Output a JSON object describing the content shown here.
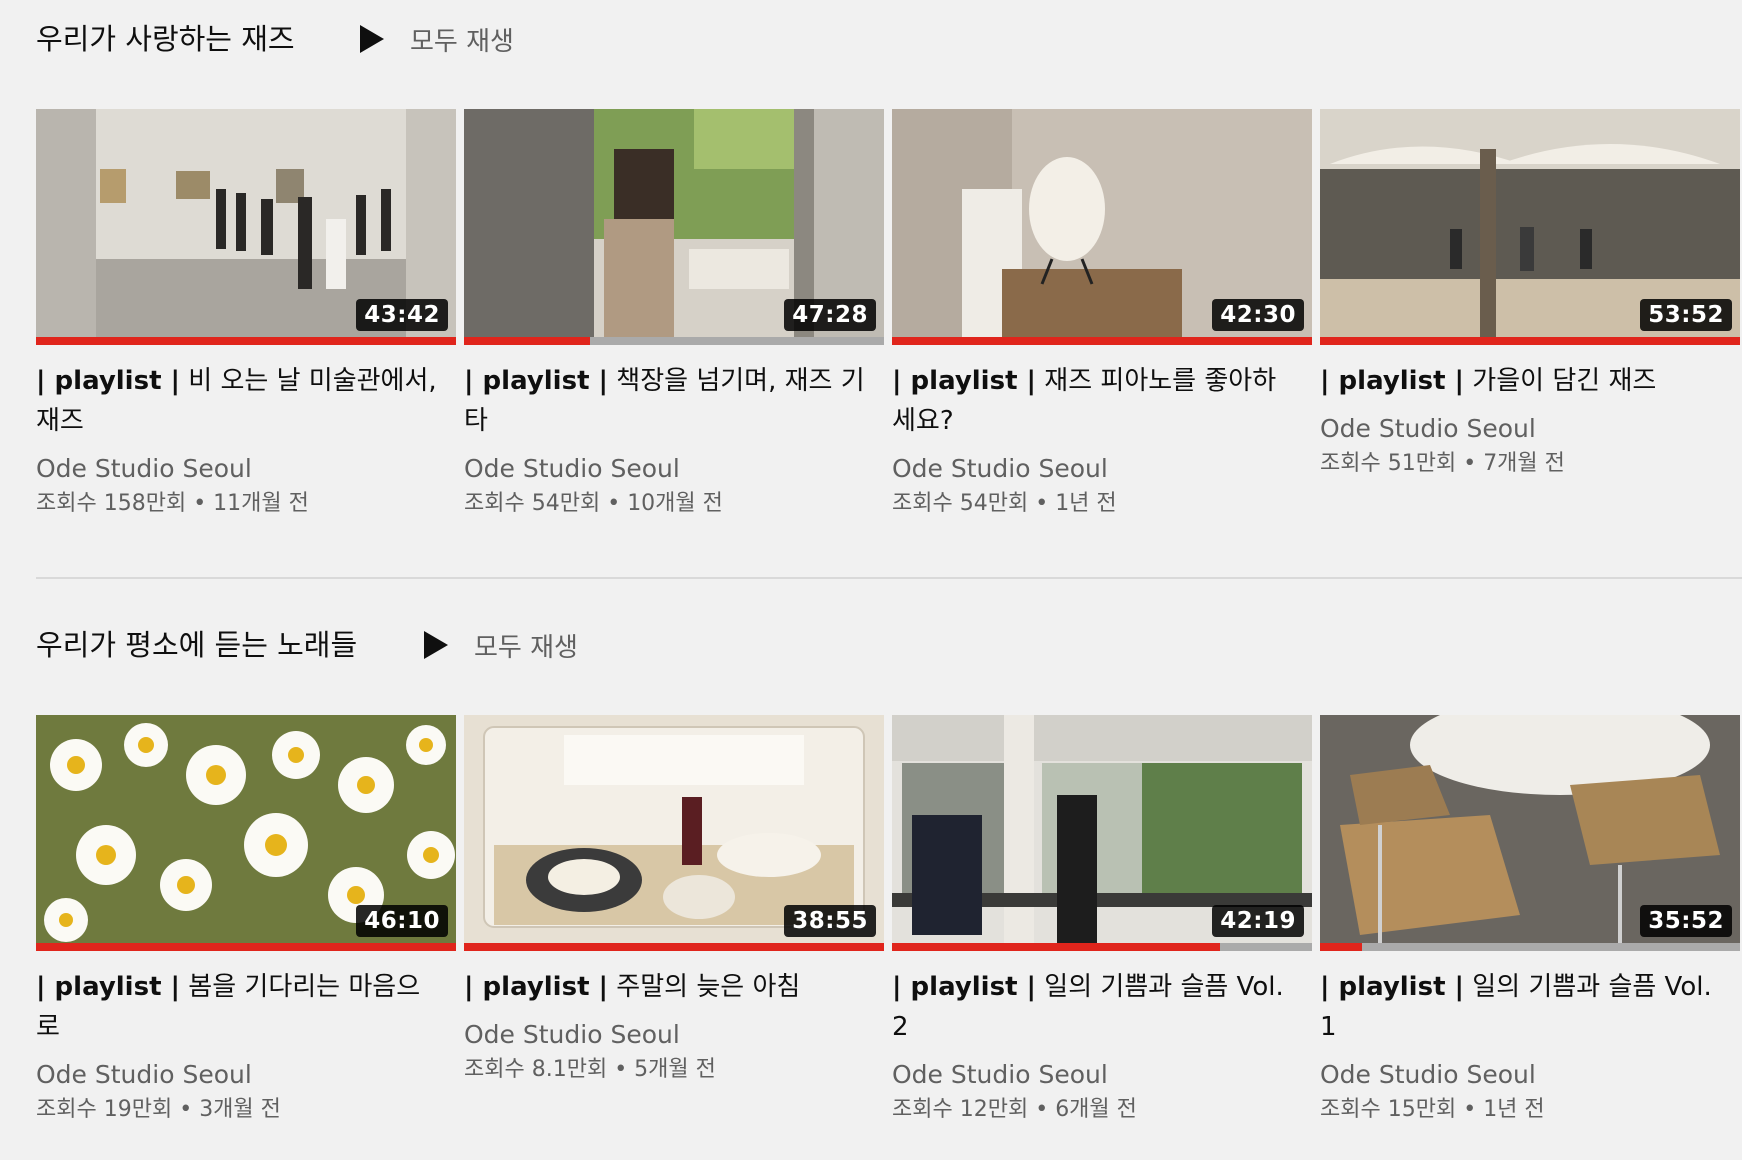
{
  "shelves": [
    {
      "title": "우리가 사랑하는 재즈",
      "play_all_label": "모두 재생",
      "videos": [
        {
          "title_tag": "| playlist |",
          "title": " 비 오는 날 미술관에서, 재즈",
          "duration": "43:42",
          "channel": "Ode Studio Seoul",
          "views": "조회수 158만회",
          "age": "11개월 전",
          "watched_fraction": 1.0
        },
        {
          "title_tag": "| playlist |",
          "title": " 책장을 넘기며, 재즈 기타",
          "duration": "47:28",
          "channel": "Ode Studio Seoul",
          "views": "조회수 54만회",
          "age": "10개월 전",
          "watched_fraction": 0.3
        },
        {
          "title_tag": "| playlist |",
          "title": " 재즈 피아노를 좋아하세요?",
          "duration": "42:30",
          "channel": "Ode Studio Seoul",
          "views": "조회수 54만회",
          "age": "1년 전",
          "watched_fraction": 1.0
        },
        {
          "title_tag": "| playlist |",
          "title": " 가을이 담긴 재즈",
          "duration": "53:52",
          "channel": "Ode Studio Seoul",
          "views": "조회수 51만회",
          "age": "7개월 전",
          "watched_fraction": 1.0
        }
      ]
    },
    {
      "title": "우리가 평소에 듣는 노래들",
      "play_all_label": "모두 재생",
      "videos": [
        {
          "title_tag": "| playlist |",
          "title": " 봄을 기다리는 마음으로",
          "duration": "46:10",
          "channel": "Ode Studio Seoul",
          "views": "조회수 19만회",
          "age": "3개월 전",
          "watched_fraction": 1.0
        },
        {
          "title_tag": "| playlist |",
          "title": " 주말의 늦은 아침",
          "duration": "38:55",
          "channel": "Ode Studio Seoul",
          "views": "조회수 8.1만회",
          "age": "5개월 전",
          "watched_fraction": 1.0
        },
        {
          "title_tag": "| playlist |",
          "title": " 일의 기쁨과 슬픔 Vol.2",
          "duration": "42:19",
          "channel": "Ode Studio Seoul",
          "views": "조회수 12만회",
          "age": "6개월 전",
          "watched_fraction": 0.78
        },
        {
          "title_tag": "| playlist |",
          "title": " 일의 기쁨과 슬픔 Vol.1",
          "duration": "35:52",
          "channel": "Ode Studio Seoul",
          "views": "조회수 15만회",
          "age": "1년 전",
          "watched_fraction": 0.1
        }
      ]
    }
  ],
  "meta_separator": "•",
  "colors": {
    "background": "#f1f1f1",
    "progress": "#e0251c",
    "secondary_text": "#606060"
  },
  "icons": {
    "play_all": "play-icon"
  }
}
